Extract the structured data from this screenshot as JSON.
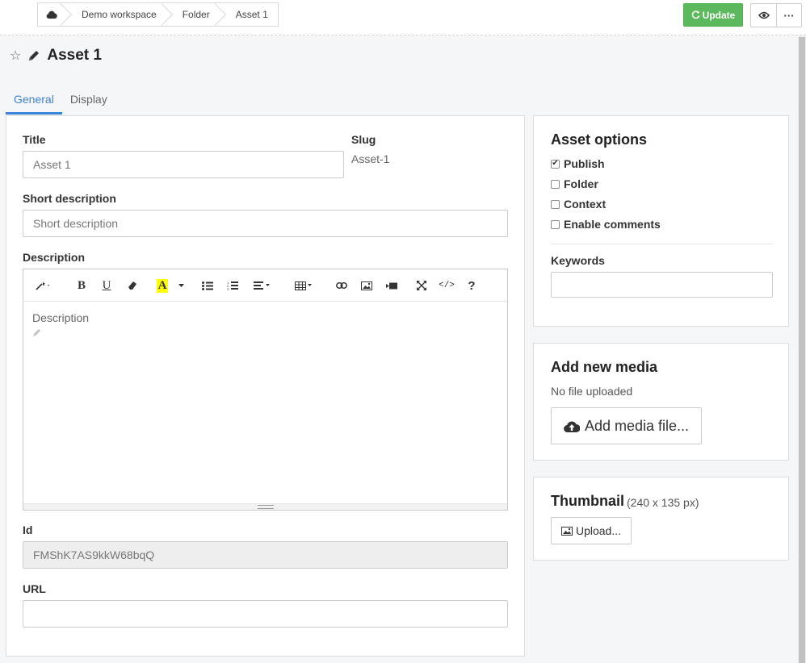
{
  "breadcrumb": {
    "home_icon": "cloud-icon",
    "items": [
      "Demo workspace",
      "Folder",
      "Asset 1"
    ]
  },
  "toolbar": {
    "update_label": "Update",
    "update_icon": "refresh-icon",
    "preview_icon": "eye-icon",
    "more_label": "···"
  },
  "page": {
    "title": "Asset 1",
    "favorite_icon": "star-outline-icon",
    "edit_icon": "pencil-icon"
  },
  "tabs": [
    {
      "label": "General",
      "active": true
    },
    {
      "label": "Display",
      "active": false
    }
  ],
  "form": {
    "title_label": "Title",
    "title_value": "Asset 1",
    "slug_label": "Slug",
    "slug_value": "Asset-1",
    "short_desc_label": "Short description",
    "short_desc_placeholder": "Short description",
    "description_label": "Description",
    "description_placeholder": "Description",
    "id_label": "Id",
    "id_value": "FMShK7AS9kkW68bqQ",
    "url_label": "URL",
    "url_value": ""
  },
  "editor_toolbar": {
    "bold": "B",
    "underline": "U",
    "highlight": "A",
    "help": "?",
    "code": "</>"
  },
  "asset_options": {
    "title": "Asset options",
    "options": [
      {
        "label": "Publish",
        "checked": true
      },
      {
        "label": "Folder",
        "checked": false
      },
      {
        "label": "Context",
        "checked": false
      },
      {
        "label": "Enable comments",
        "checked": false
      }
    ],
    "keywords_label": "Keywords",
    "keywords_value": ""
  },
  "media": {
    "title": "Add new media",
    "status": "No file uploaded",
    "add_button": "Add media file..."
  },
  "thumbnail": {
    "title": "Thumbnail",
    "size_hint": "(240 x 135 px)",
    "upload_button": "Upload..."
  },
  "colors": {
    "accent": "#3a84d8",
    "success": "#5cb85c"
  }
}
